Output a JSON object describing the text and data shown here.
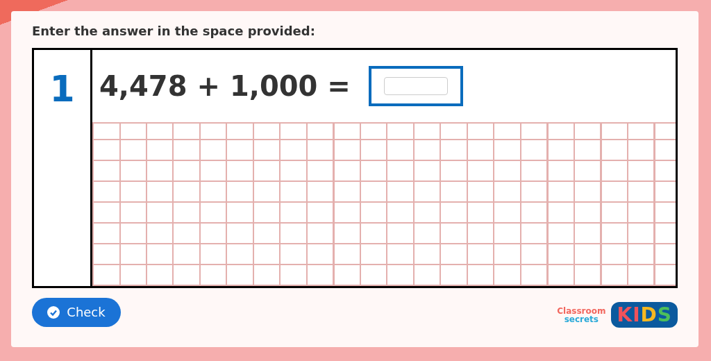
{
  "instruction": "Enter the answer in the space provided:",
  "question": {
    "number": "1",
    "equation": "4,478 + 1,000 ="
  },
  "check_button": {
    "label": "Check"
  },
  "logo": {
    "line_1": "Classroom",
    "line_2": "secrets",
    "badge_letters": [
      {
        "text": "K",
        "color": "#f0525a"
      },
      {
        "text": "I",
        "color": "#f0525a"
      },
      {
        "text": "D",
        "color": "#f6b820"
      },
      {
        "text": "S",
        "color": "#4cbf5a"
      }
    ]
  }
}
